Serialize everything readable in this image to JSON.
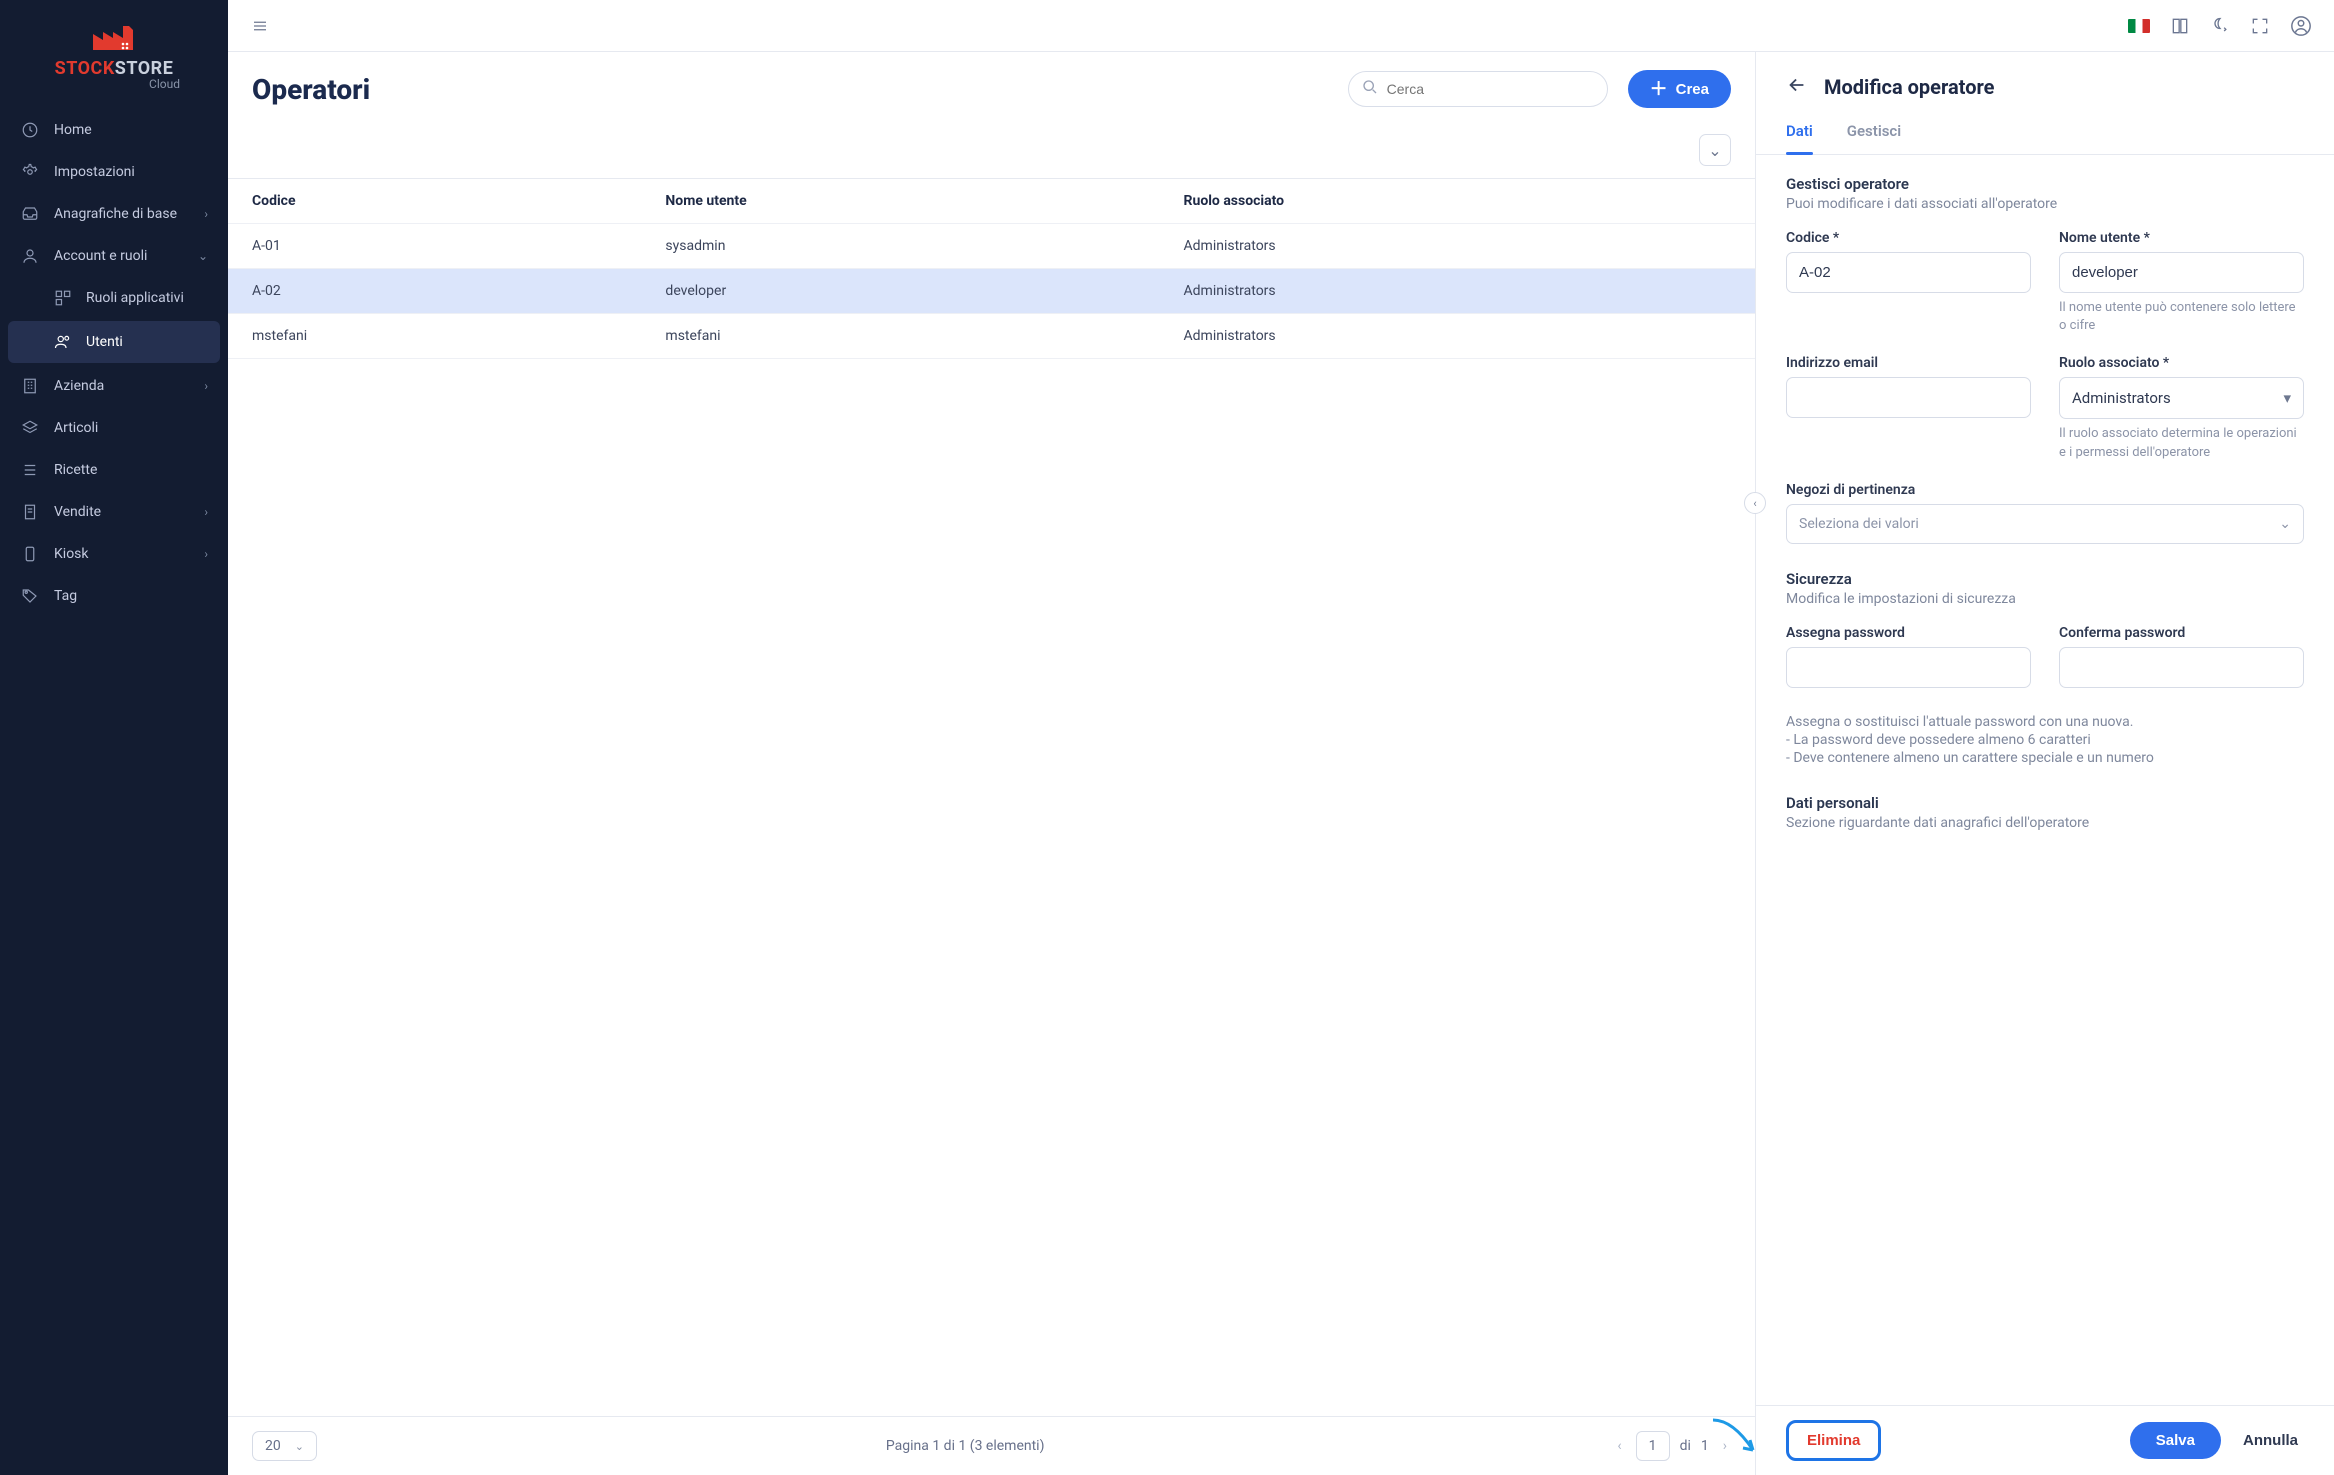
{
  "brand": {
    "name1": "STOCK",
    "name2": "STORE",
    "sub": "Cloud"
  },
  "sidebar": {
    "items": [
      {
        "label": "Home"
      },
      {
        "label": "Impostazioni"
      },
      {
        "label": "Anagrafiche di base"
      },
      {
        "label": "Account e ruoli"
      },
      {
        "label": "Azienda"
      },
      {
        "label": "Articoli"
      },
      {
        "label": "Ricette"
      },
      {
        "label": "Vendite"
      },
      {
        "label": "Kiosk"
      },
      {
        "label": "Tag"
      }
    ],
    "subs": [
      {
        "label": "Ruoli applicativi"
      },
      {
        "label": "Utenti"
      }
    ]
  },
  "list": {
    "title": "Operatori",
    "searchPlaceholder": "Cerca",
    "createLabel": "Crea",
    "columns": {
      "code": "Codice",
      "user": "Nome utente",
      "role": "Ruolo associato"
    },
    "rows": [
      {
        "code": "A-01",
        "user": "sysadmin",
        "role": "Administrators"
      },
      {
        "code": "A-02",
        "user": "developer",
        "role": "Administrators"
      },
      {
        "code": "mstefani",
        "user": "mstefani",
        "role": "Administrators"
      }
    ],
    "paginator": {
      "pageSize": "20",
      "summary": "Pagina 1 di 1 (3 elementi)",
      "current": "1",
      "ofLabel": "di",
      "total": "1"
    }
  },
  "detail": {
    "title": "Modifica operatore",
    "tabs": {
      "data": "Dati",
      "manage": "Gestisci"
    },
    "section1": {
      "lead": "Gestisci operatore",
      "sub": "Puoi modificare i dati associati all'operatore"
    },
    "fields": {
      "codeLabel": "Codice",
      "codeValue": "A-02",
      "userLabel": "Nome utente",
      "userValue": "developer",
      "userHint": "Il nome utente può contenere solo lettere o cifre",
      "emailLabel": "Indirizzo email",
      "emailValue": "",
      "roleLabel": "Ruolo associato",
      "roleValue": "Administrators",
      "roleHint": "Il ruolo associato determina le operazioni e i permessi dell'operatore",
      "storesLabel": "Negozi di pertinenza",
      "storesPlaceholder": "Seleziona dei valori"
    },
    "section2": {
      "lead": "Sicurezza",
      "sub": "Modifica le impostazioni di sicurezza"
    },
    "security": {
      "pw1Label": "Assegna password",
      "pw2Label": "Conferma password",
      "note1": "Assegna o sostituisci l'attuale password con una nuova.",
      "note2": "- La password deve possedere almeno 6 caratteri",
      "note3": "- Deve contenere almeno un carattere speciale e un numero"
    },
    "section3": {
      "lead": "Dati personali",
      "sub": "Sezione riguardante dati anagrafici dell'operatore"
    },
    "actions": {
      "delete": "Elimina",
      "save": "Salva",
      "cancel": "Annulla"
    }
  }
}
